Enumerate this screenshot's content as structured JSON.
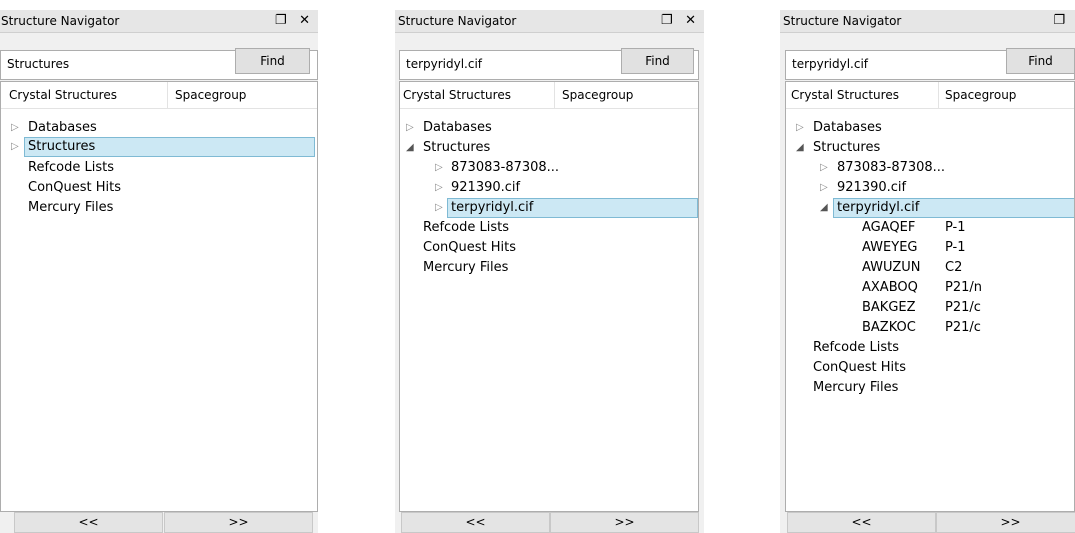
{
  "panels": [
    {
      "title": "Structure Navigator",
      "controls": "❐ ✕",
      "search_value": "Structures",
      "find_label": "Find",
      "col1": "Crystal Structures",
      "col2": "Spacegroup",
      "prev_label": "<<",
      "next_label": ">>",
      "tree": {
        "databases": "Databases",
        "structures": "Structures",
        "refcode": "Refcode Lists",
        "conquest": "ConQuest Hits",
        "mercury": "Mercury Files"
      }
    },
    {
      "title": "Structure Navigator",
      "controls": "❐ ✕",
      "search_value": "terpyridyl.cif",
      "find_label": "Find",
      "col1": "Crystal Structures",
      "col2": "Spacegroup",
      "prev_label": "<<",
      "next_label": ">>",
      "tree": {
        "databases": "Databases",
        "structures": "Structures",
        "child1": "873083-87308...",
        "child2": "921390.cif",
        "child3": "terpyridyl.cif",
        "refcode": "Refcode Lists",
        "conquest": "ConQuest Hits",
        "mercury": "Mercury Files"
      }
    },
    {
      "title": "Structure Navigator",
      "controls": "❐",
      "search_value": "terpyridyl.cif",
      "find_label": "Find",
      "col1": "Crystal Structures",
      "col2": "Spacegroup",
      "prev_label": "<<",
      "next_label": ">>",
      "tree": {
        "databases": "Databases",
        "structures": "Structures",
        "child1": "873083-87308...",
        "child2": "921390.cif",
        "child3": "terpyridyl.cif",
        "entries": [
          {
            "refcode": "AGAQEF",
            "spacegroup": "P-1"
          },
          {
            "refcode": "AWEYEG",
            "spacegroup": "P-1"
          },
          {
            "refcode": "AWUZUN",
            "spacegroup": "C2"
          },
          {
            "refcode": "AXABOQ",
            "spacegroup": "P21/n"
          },
          {
            "refcode": "BAKGEZ",
            "spacegroup": "P21/c"
          },
          {
            "refcode": "BAZKOC",
            "spacegroup": "P21/c"
          }
        ],
        "refcode": "Refcode Lists",
        "conquest": "ConQuest Hits",
        "mercury": "Mercury Files"
      }
    }
  ],
  "icons": {
    "collapsed": "▷",
    "expanded": "◢"
  }
}
